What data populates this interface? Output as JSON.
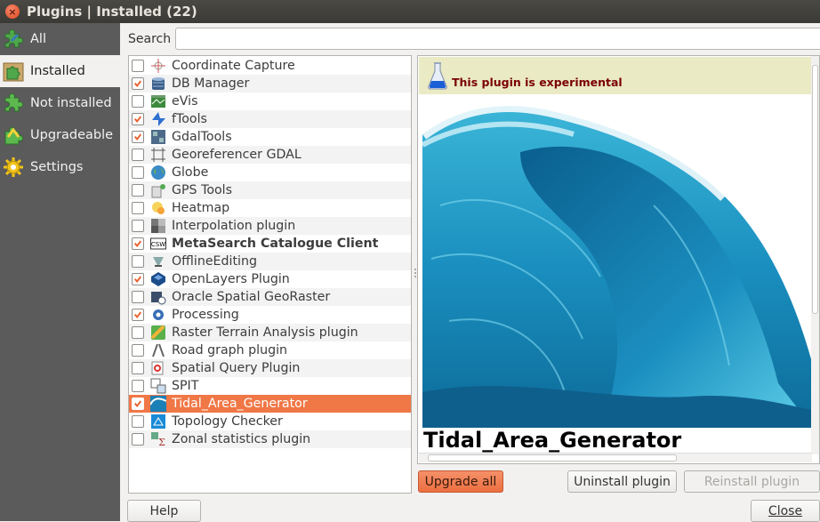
{
  "window": {
    "title": "Plugins | Installed (22)"
  },
  "sidebar": {
    "items": [
      {
        "label": "All",
        "icon": "puzzle-all-icon"
      },
      {
        "label": "Installed",
        "icon": "puzzle-installed-icon"
      },
      {
        "label": "Not installed",
        "icon": "puzzle-not-installed-icon"
      },
      {
        "label": "Upgradeable",
        "icon": "puzzle-upgradeable-icon"
      },
      {
        "label": "Settings",
        "icon": "gear-icon"
      }
    ],
    "active_index": 1
  },
  "search": {
    "label": "Search",
    "value": "",
    "placeholder": ""
  },
  "plugins": [
    {
      "name": "Coordinate Capture",
      "checked": false,
      "icon": "crosshair-icon"
    },
    {
      "name": "DB Manager",
      "checked": true,
      "icon": "database-icon"
    },
    {
      "name": "eVis",
      "checked": false,
      "icon": "evis-icon"
    },
    {
      "name": "fTools",
      "checked": true,
      "icon": "ftools-icon"
    },
    {
      "name": "GdalTools",
      "checked": true,
      "icon": "gdal-icon"
    },
    {
      "name": "Georeferencer GDAL",
      "checked": false,
      "icon": "georeferencer-icon"
    },
    {
      "name": "Globe",
      "checked": false,
      "icon": "globe-icon"
    },
    {
      "name": "GPS Tools",
      "checked": false,
      "icon": "gps-icon"
    },
    {
      "name": "Heatmap",
      "checked": false,
      "icon": "heatmap-icon"
    },
    {
      "name": "Interpolation plugin",
      "checked": false,
      "icon": "interpolation-icon"
    },
    {
      "name": "MetaSearch Catalogue Client",
      "checked": true,
      "icon": "csw-icon",
      "bold": true
    },
    {
      "name": "OfflineEditing",
      "checked": false,
      "icon": "offline-editing-icon"
    },
    {
      "name": "OpenLayers Plugin",
      "checked": true,
      "icon": "openlayers-icon"
    },
    {
      "name": "Oracle Spatial GeoRaster",
      "checked": false,
      "icon": "oracle-icon"
    },
    {
      "name": "Processing",
      "checked": true,
      "icon": "processing-gear-icon"
    },
    {
      "name": "Raster Terrain Analysis plugin",
      "checked": false,
      "icon": "terrain-icon"
    },
    {
      "name": "Road graph plugin",
      "checked": false,
      "icon": "road-graph-icon"
    },
    {
      "name": "Spatial Query Plugin",
      "checked": false,
      "icon": "spatial-query-icon"
    },
    {
      "name": "SPIT",
      "checked": false,
      "icon": "spit-icon"
    },
    {
      "name": "Tidal_Area_Generator",
      "checked": true,
      "icon": "tidal-icon",
      "selected": true
    },
    {
      "name": "Topology Checker",
      "checked": false,
      "icon": "topology-icon"
    },
    {
      "name": "Zonal statistics plugin",
      "checked": false,
      "icon": "zonal-stats-icon"
    }
  ],
  "detail": {
    "banner_text": "This plugin is experimental",
    "plugin_title": "Tidal_Area_Generator"
  },
  "buttons": {
    "upgrade_all": "Upgrade all",
    "uninstall": "Uninstall plugin",
    "reinstall": "Reinstall plugin",
    "help": "Help",
    "close": "Close"
  },
  "colors": {
    "accent": "#f07746",
    "sidebar": "#5b5b5b",
    "banner": "#eaeac5",
    "banner_text": "#7a0000"
  }
}
